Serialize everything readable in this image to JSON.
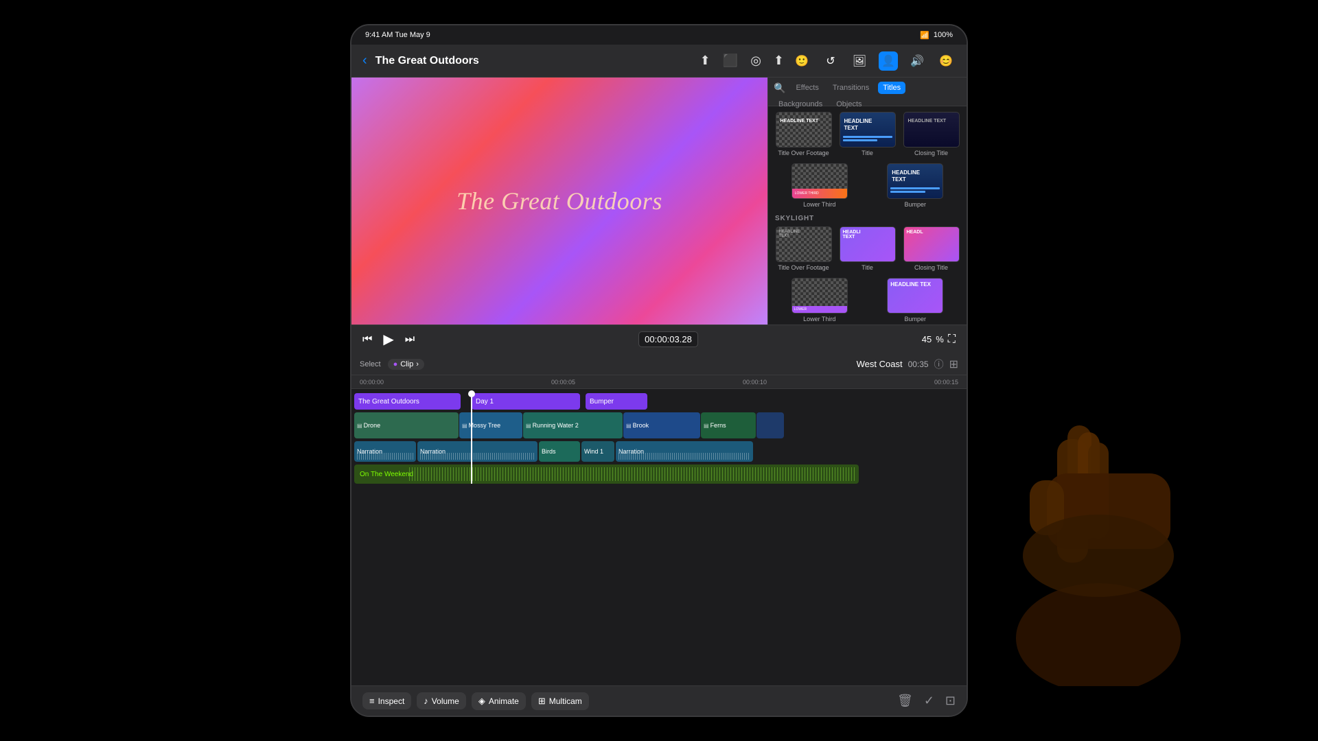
{
  "device": {
    "status_bar": {
      "time": "9:41 AM  Tue May 9",
      "battery": "100%",
      "wifi": "WiFi"
    }
  },
  "toolbar": {
    "back_label": "‹",
    "project_title": "The Great Outdoors",
    "icons": [
      "share",
      "camera",
      "record",
      "export"
    ]
  },
  "top_right_icons": [
    "face",
    "rotate",
    "photo",
    "person",
    "speaker",
    "smiley"
  ],
  "preview": {
    "title": "The Great Outdoors"
  },
  "sidebar": {
    "tabs": [
      "search",
      "Effects",
      "Transitions",
      "Titles",
      "Backgrounds",
      "Objects"
    ],
    "active_tab": "Titles",
    "section1": {
      "label": "",
      "items": [
        {
          "label": "Title Over Footage"
        },
        {
          "label": "Title"
        },
        {
          "label": "Closing Title"
        }
      ]
    },
    "section2": {
      "label": "Lower Third",
      "items": [
        {
          "label": "Lower Third"
        },
        {
          "label": "Bumper"
        }
      ]
    },
    "section3": {
      "label": "SKYLIGHT",
      "items": [
        {
          "label": "Title Over Footage"
        },
        {
          "label": "Title"
        },
        {
          "label": "Closing Title"
        }
      ]
    },
    "section4": {
      "items": [
        {
          "label": "Lower Third"
        },
        {
          "label": "Bumper"
        }
      ]
    }
  },
  "playback": {
    "timecode": "00:00:03.28",
    "zoom": "45",
    "zoom_unit": "%"
  },
  "timeline": {
    "select_label": "Select",
    "clip_label": "Clip",
    "west_coast": "West Coast",
    "west_coast_time": "00:35",
    "ruler_marks": [
      "00:00:00",
      "00:00:05",
      "00:00:10",
      "00:00:15"
    ],
    "title_clips": [
      {
        "label": "The Great Outdoors"
      },
      {
        "label": "Day 1"
      },
      {
        "label": "Bumper"
      }
    ],
    "video_clips": [
      {
        "label": "Drone"
      },
      {
        "label": "Mossy Tree"
      },
      {
        "label": "Running Water 2"
      },
      {
        "label": "Brook"
      },
      {
        "label": "Ferns"
      }
    ],
    "audio_clips": [
      {
        "label": "Narration"
      },
      {
        "label": "Narration"
      },
      {
        "label": "Birds"
      },
      {
        "label": "Wind 1"
      },
      {
        "label": "Narration"
      }
    ],
    "music_clip": {
      "label": "On The Weekend"
    }
  },
  "bottom_toolbar": {
    "buttons": [
      {
        "label": "Inspect",
        "icon": "≡"
      },
      {
        "label": "Volume",
        "icon": "♪"
      },
      {
        "label": "Animate",
        "icon": "◈"
      },
      {
        "label": "Multicam",
        "icon": "⊞"
      }
    ],
    "right_icons": [
      "trash",
      "checkmark",
      "layout"
    ]
  }
}
